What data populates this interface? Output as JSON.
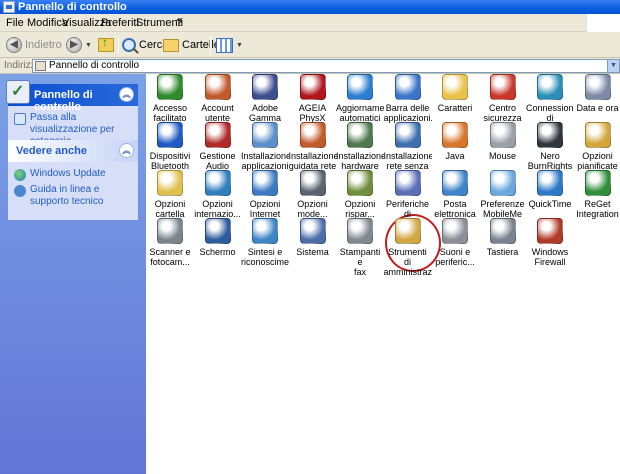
{
  "window": {
    "title": "Pannello di controllo"
  },
  "menu": [
    "File",
    "Modifica",
    "Visualizza",
    "Preferiti",
    "Strumenti",
    "?"
  ],
  "toolbar": {
    "back_label": "Indietro",
    "search_label": "Cerca",
    "folders_label": "Cartelle"
  },
  "address": {
    "label": "Indirizzo",
    "value": "Pannello di controllo"
  },
  "taskpane": {
    "panel1": {
      "title": "Pannello di controllo",
      "link": "Passa alla visualizzazione per categorie"
    },
    "panel2": {
      "title": "Vedere anche",
      "links": [
        "Windows Update",
        "Guida in linea e supporto tecnico"
      ]
    }
  },
  "items": [
    {
      "label": "Accesso\nfacilitato",
      "icon": "accessibility-icon",
      "color": "#2e8b2e"
    },
    {
      "label": "Account\nutente",
      "icon": "user-accounts-icon",
      "color": "#c45a2b"
    },
    {
      "label": "Adobe Gamma",
      "icon": "monitor-icon",
      "color": "#3d4e8f"
    },
    {
      "label": "AGEIA PhysX",
      "icon": "ageia-icon",
      "color": "#b0161b"
    },
    {
      "label": "Aggiornamenti\nautomatici",
      "icon": "windows-update-icon",
      "color": "#2c7fd0"
    },
    {
      "label": "Barra delle\napplicazioni...",
      "icon": "taskbar-icon",
      "color": "#3a75c9"
    },
    {
      "label": "Caratteri",
      "icon": "fonts-folder-icon",
      "color": "#e8c24a"
    },
    {
      "label": "Centro\nsicurezza PC",
      "icon": "security-shield-icon",
      "color": "#c9372c"
    },
    {
      "label": "Connessioni di\nrete",
      "icon": "network-globe-icon",
      "color": "#2a8fb8"
    },
    {
      "label": "Data e ora",
      "icon": "clock-icon",
      "color": "#7c8aa8"
    },
    {
      "label": "Dispositivi\nBluetooth",
      "icon": "bluetooth-icon",
      "color": "#1f5bc2"
    },
    {
      "label": "Gestione\nAudio Real...",
      "icon": "speaker-icon",
      "color": "#b02a2a"
    },
    {
      "label": "Installazione\napplicazioni",
      "icon": "add-remove-icon",
      "color": "#5b8fc9"
    },
    {
      "label": "Installazione\nguidata rete",
      "icon": "home-network-icon",
      "color": "#c25a2a"
    },
    {
      "label": "Installazione\nhardware",
      "icon": "hardware-icon",
      "color": "#4e7a4e"
    },
    {
      "label": "Installazione\nrete senza fili",
      "icon": "wireless-icon",
      "color": "#3d6fb0"
    },
    {
      "label": "Java",
      "icon": "java-icon",
      "color": "#d9762a"
    },
    {
      "label": "Mouse",
      "icon": "mouse-icon",
      "color": "#9aa0a8"
    },
    {
      "label": "Nero\nBurnRights",
      "icon": "nero-icon",
      "color": "#30363f"
    },
    {
      "label": "Opzioni\npianificate",
      "icon": "scheduled-tasks-icon",
      "color": "#d4a63a"
    },
    {
      "label": "Opzioni\ncartella",
      "icon": "folder-options-icon",
      "color": "#e1c04d"
    },
    {
      "label": "Opzioni\ninternazio...",
      "icon": "regional-globe-icon",
      "color": "#2f7fbf"
    },
    {
      "label": "Opzioni\nInternet",
      "icon": "internet-options-icon",
      "color": "#3b7bc4"
    },
    {
      "label": "Opzioni\nmode...",
      "icon": "modem-icon",
      "color": "#5a6470"
    },
    {
      "label": "Opzioni\nrispar...",
      "icon": "power-icon",
      "color": "#6f8f3b"
    },
    {
      "label": "Periferiche di\ngioco",
      "icon": "gamepad-icon",
      "color": "#5b6fb8"
    },
    {
      "label": "Posta\nelettronica",
      "icon": "mail-icon",
      "color": "#3f83c9"
    },
    {
      "label": "Preferenze\nMobileMe",
      "icon": "mobileme-icon",
      "color": "#6aa7e0"
    },
    {
      "label": "QuickTime",
      "icon": "quicktime-icon",
      "color": "#2c79c8"
    },
    {
      "label": "ReGet\nIntegration",
      "icon": "reget-icon",
      "color": "#2f8f3a"
    },
    {
      "label": "Scanner e\nfotocam...",
      "icon": "scanner-icon",
      "color": "#7b858f"
    },
    {
      "label": "Schermo",
      "icon": "display-icon",
      "color": "#2e5c9e"
    },
    {
      "label": "Sintesi e\nriconoscime...",
      "icon": "speech-icon",
      "color": "#3d85c6"
    },
    {
      "label": "Sistema",
      "icon": "system-icon",
      "color": "#4c6ea8"
    },
    {
      "label": "Stampanti e\nfax",
      "icon": "printer-icon",
      "color": "#808890"
    },
    {
      "label": "Strumenti di\namministrazione",
      "icon": "admin-tools-icon",
      "color": "#d2a640"
    },
    {
      "label": "Suoni e\nperiferic...",
      "icon": "sound-icon",
      "color": "#8b8f96"
    },
    {
      "label": "Tastiera",
      "icon": "keyboard-icon",
      "color": "#7a8392"
    },
    {
      "label": "Windows\nFirewall",
      "icon": "firewall-icon",
      "color": "#b23a2a"
    }
  ]
}
